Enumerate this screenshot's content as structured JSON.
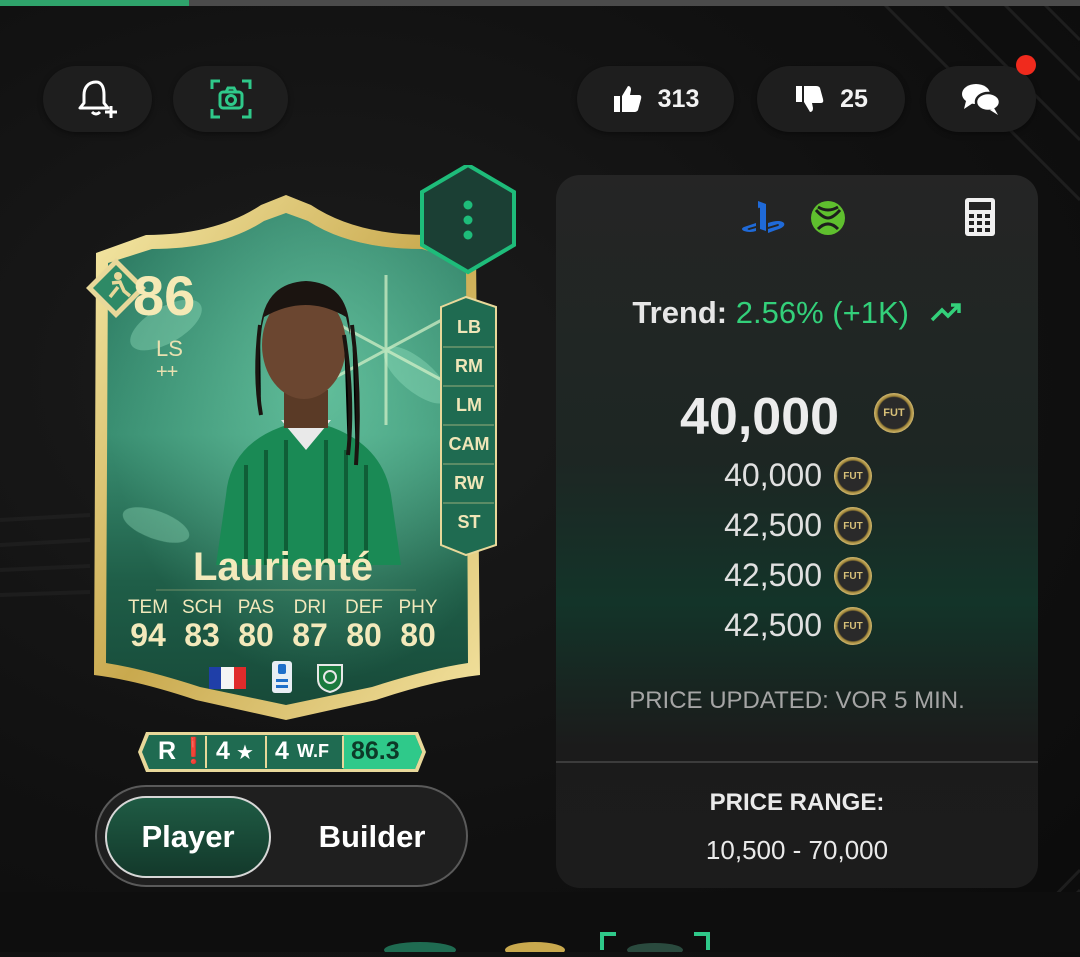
{
  "progress": {
    "fraction": 0.175,
    "color": "#2fa36b"
  },
  "toolbar": {
    "bell_icon": "bell-plus-icon",
    "camera_icon": "screenshot-icon",
    "likes": "313",
    "dislikes": "25",
    "comments_icon": "chat-bubbles-icon",
    "notification_dot_color": "#f02a1d"
  },
  "card": {
    "rating": "86",
    "position": "LS",
    "playstyle_plus": "++",
    "name": "Laurienté",
    "stats": [
      {
        "label": "TEM",
        "value": "94"
      },
      {
        "label": "SCH",
        "value": "83"
      },
      {
        "label": "PAS",
        "value": "80"
      },
      {
        "label": "DRI",
        "value": "87"
      },
      {
        "label": "DEF",
        "value": "80"
      },
      {
        "label": "PHY",
        "value": "80"
      }
    ],
    "alt_positions": [
      "LB",
      "RM",
      "LM",
      "CAM",
      "RW",
      "ST"
    ],
    "nation": "France",
    "accent_color": "#1ebc7a"
  },
  "info_bar": {
    "foot": "R",
    "skill_moves": "4",
    "weak_foot": "4",
    "weak_foot_label": "W.F",
    "score": "86.3"
  },
  "toggle": {
    "player": "Player",
    "builder": "Builder",
    "active": "player"
  },
  "price_panel": {
    "platforms": [
      "playstation-icon",
      "xbox-icon"
    ],
    "calculator_icon": "calculator-icon",
    "trend_label": "Trend:",
    "trend_value": "2.56% (+1K)",
    "trend_color": "#33d07a",
    "main_price": "40,000",
    "prices": [
      "40,000",
      "42,500",
      "42,500",
      "42,500"
    ],
    "coin_label": "FUT",
    "updated": "PRICE UPDATED: VOR 5 MIN.",
    "range_label": "PRICE RANGE:",
    "range_value": "10,500 - 70,000"
  }
}
